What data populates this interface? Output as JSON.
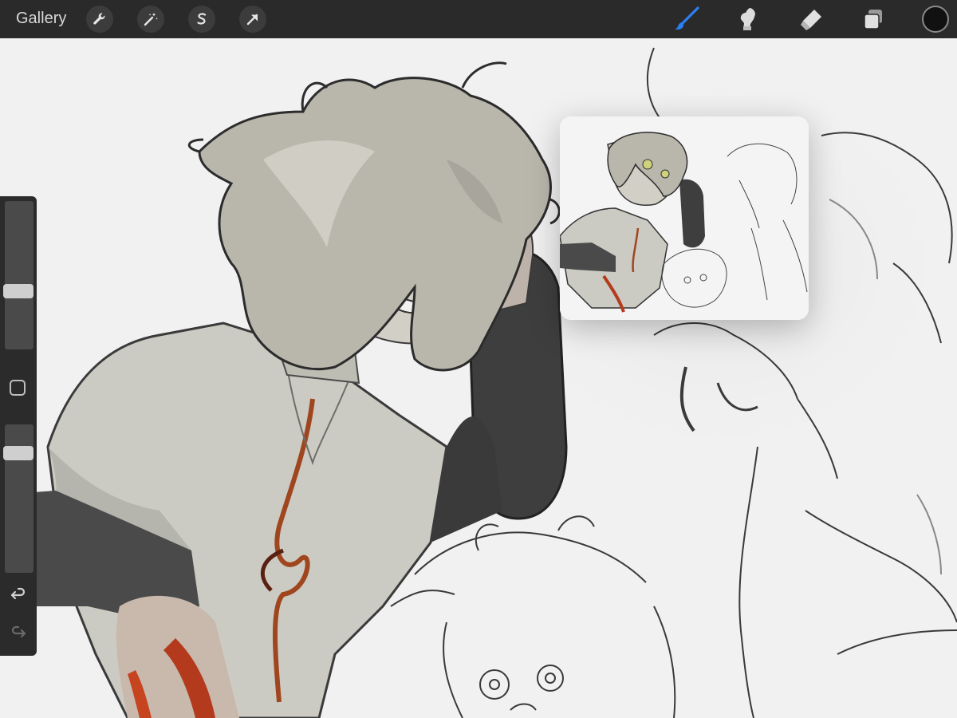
{
  "toolbar": {
    "gallery_label": "Gallery",
    "left_tools": [
      "wrench-icon",
      "magic-wand-icon",
      "selection-s-icon",
      "transform-arrow-icon"
    ],
    "right_tools": [
      "brush-icon",
      "smudge-icon",
      "eraser-icon",
      "layers-icon"
    ],
    "active_tool": "brush-icon",
    "accent_color": "#2a7ff2",
    "current_color": "#111111"
  },
  "sidebar": {
    "brush_size_level": 0.32,
    "opacity_level": 0.77,
    "buttons": [
      "modify-button",
      "undo-icon",
      "redo-icon"
    ]
  },
  "reference_window": {
    "visible": true
  },
  "canvas": {
    "background": "#f1f1f1"
  }
}
